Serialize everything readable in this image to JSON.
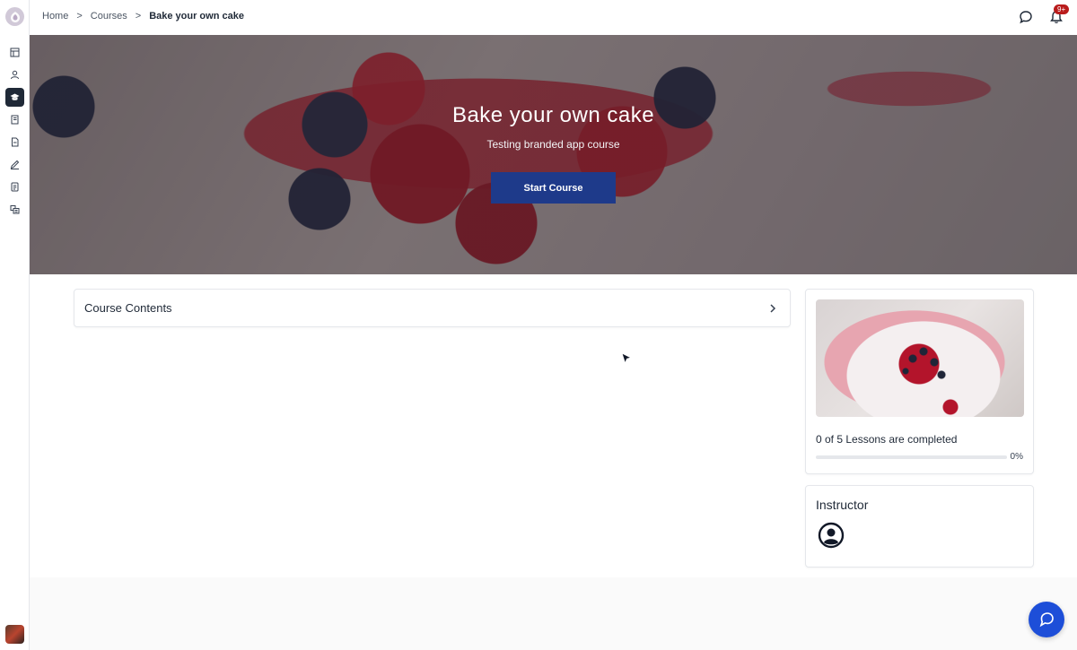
{
  "breadcrumb": {
    "home": "Home",
    "courses": "Courses",
    "current": "Bake your own cake",
    "separator": ">"
  },
  "header": {
    "notification_badge": "9+",
    "icons": [
      "chat-icon",
      "bell-icon"
    ]
  },
  "sidebar": {
    "items": [
      {
        "icon": "dashboard-icon",
        "active": false
      },
      {
        "icon": "users-icon",
        "active": false
      },
      {
        "icon": "graduation-cap-icon",
        "active": true
      },
      {
        "icon": "book-icon",
        "active": false
      },
      {
        "icon": "document-icon",
        "active": false
      },
      {
        "icon": "pen-icon",
        "active": false
      },
      {
        "icon": "file-icon",
        "active": false
      },
      {
        "icon": "library-icon",
        "active": false
      }
    ]
  },
  "hero": {
    "title": "Bake your own cake",
    "subtitle": "Testing branded app course",
    "start_button": "Start Course"
  },
  "course_contents": {
    "title": "Course Contents"
  },
  "progress": {
    "lessons_text": "0 of 5 Lessons are completed",
    "percent_label": "0%",
    "fraction": 0
  },
  "instructor": {
    "title": "Instructor"
  },
  "colors": {
    "accent": "#1e3a8a",
    "support_button": "#1d4ed8",
    "badge": "#b91c1c"
  }
}
